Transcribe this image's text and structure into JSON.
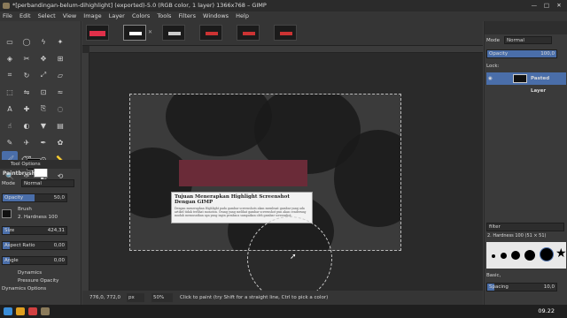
{
  "window": {
    "title": "*[perbandingan-belum-dihighlight] (exported)-5.0 (RGB color, 1 layer) 1366x768 – GIMP",
    "controls": [
      "—",
      "□",
      "✕"
    ]
  },
  "menu": [
    "File",
    "Edit",
    "Select",
    "View",
    "Image",
    "Layer",
    "Colors",
    "Tools",
    "Filters",
    "Windows",
    "Help"
  ],
  "toolbox": {
    "icons": [
      "rect-select",
      "ellipse-select",
      "free-select",
      "fuzzy-select",
      "select-by-color",
      "scissors",
      "move",
      "align",
      "crop",
      "rotate",
      "scale",
      "shear",
      "perspective",
      "flip",
      "cage",
      "warp",
      "text",
      "heal",
      "clone",
      "blur",
      "smudge",
      "dodge",
      "bucket",
      "gradient",
      "pencil",
      "airbrush",
      "ink",
      "mypaint",
      "paintbrush",
      "eraser",
      "color-picker",
      "measure",
      "zoom",
      "paths",
      "foreground-select",
      "unified-transform"
    ],
    "glyphs": [
      "▭",
      "◯",
      "ϟ",
      "✦",
      "◈",
      "✂",
      "✥",
      "⊞",
      "⌗",
      "↻",
      "⤢",
      "▱",
      "⬚",
      "⇋",
      "⊡",
      "≈",
      "A",
      "✚",
      "⎘",
      "◌",
      "☝",
      "◐",
      "▼",
      "▤",
      "✎",
      "✈",
      "✒",
      "✿",
      "🖌",
      "⌫",
      "⊙",
      "📏",
      "🔍",
      "✑",
      "◧",
      "⟲"
    ],
    "active_index": 28
  },
  "tool_options": {
    "tab": "Tool Options",
    "title": "Paintbrush",
    "mode_label": "Mode",
    "mode_value": "Normal",
    "opacity_label": "Opacity",
    "opacity_value": "50,0",
    "opacity_fraction": 0.5,
    "brush_label": "Brush",
    "brush_name": "2. Hardness 100",
    "size_label": "Size",
    "size_value": "424,31",
    "aspect_label": "Aspect Ratio",
    "aspect_value": "0,00",
    "angle_label": "Angle",
    "angle_value": "0,00",
    "dynamics_label": "Dynamics",
    "dynamics_value": "Pressure Opacity",
    "dynamics_options": "Dynamics Options"
  },
  "canvas": {
    "card_title": "Tujuan Menerapkan Highlight Screenshot Dengan GIMP",
    "card_text": "Dengan menerapkan Highlight pada gambar screenshots akan membuat gambar yang ada artikel tidak terlihat monoton. Orang yang melihat gambar screenshot pun akan cenderung mudah memusatkan apa yang ingin pembaca sampaikan oleh gambar screenshot."
  },
  "status": {
    "coords": "776,0, 772,0",
    "unit": "px",
    "zoom": "50%",
    "message": "Click to paint (try Shift for a straight line, Ctrl to pick a color)"
  },
  "right_panel": {
    "mode_label": "Mode",
    "mode_value": "Normal",
    "opacity_label": "Opacity",
    "opacity_value": "100,0",
    "lock_label": "Lock:",
    "layer_name": "Pasted Layer",
    "filter_placeholder": "filter",
    "brush_name": "2. Hardness 100 (51 × 51)",
    "preset": "Basic,",
    "spacing_label": "Spacing",
    "spacing_value": "10,0"
  },
  "taskbar": {
    "clock": "09.22"
  }
}
